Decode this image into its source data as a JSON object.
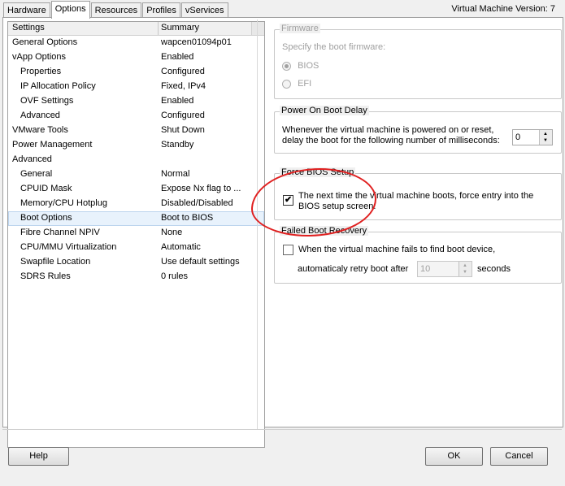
{
  "tabs": [
    "Hardware",
    "Options",
    "Resources",
    "Profiles",
    "vServices"
  ],
  "vm_version_label": "Virtual Machine Version: 7",
  "list": {
    "headers": {
      "settings": "Settings",
      "summary": "Summary"
    },
    "rows": [
      {
        "name": "General Options",
        "summary": "wapcen01094p01"
      },
      {
        "name": "vApp Options",
        "summary": "Enabled"
      },
      {
        "name": "Properties",
        "summary": "Configured"
      },
      {
        "name": "IP Allocation Policy",
        "summary": "Fixed, IPv4"
      },
      {
        "name": "OVF Settings",
        "summary": "Enabled"
      },
      {
        "name": "Advanced",
        "summary": "Configured"
      },
      {
        "name": "VMware Tools",
        "summary": "Shut Down"
      },
      {
        "name": "Power Management",
        "summary": "Standby"
      },
      {
        "name": "Advanced",
        "summary": ""
      },
      {
        "name": "General",
        "summary": "Normal"
      },
      {
        "name": "CPUID Mask",
        "summary": "Expose Nx flag to ..."
      },
      {
        "name": "Memory/CPU Hotplug",
        "summary": "Disabled/Disabled"
      },
      {
        "name": "Boot Options",
        "summary": "Boot to BIOS"
      },
      {
        "name": "Fibre Channel NPIV",
        "summary": "None"
      },
      {
        "name": "CPU/MMU Virtualization",
        "summary": "Automatic"
      },
      {
        "name": "Swapfile Location",
        "summary": "Use default settings"
      },
      {
        "name": "SDRS Rules",
        "summary": "0 rules"
      }
    ]
  },
  "firmware": {
    "title": "Firmware",
    "desc": "Specify the boot firmware:",
    "bios": "BIOS",
    "efi": "EFI"
  },
  "boot_delay": {
    "title": "Power On Boot Delay",
    "line1": "Whenever the virtual machine is powered on or reset,",
    "line2": "delay the boot for the following number of milliseconds:",
    "value": "0"
  },
  "force_bios": {
    "title": "Force BIOS Setup",
    "line1": "The next time the virtual machine boots, force entry into the",
    "line2": "BIOS setup screen.",
    "checked": true
  },
  "failed_boot": {
    "title": "Failed Boot Recovery",
    "line1": "When the virtual machine fails to find boot device,",
    "retry_label": "automaticaly retry boot after",
    "retry_value": "10",
    "unit": "seconds"
  },
  "buttons": {
    "help": "Help",
    "ok": "OK",
    "cancel": "Cancel"
  }
}
